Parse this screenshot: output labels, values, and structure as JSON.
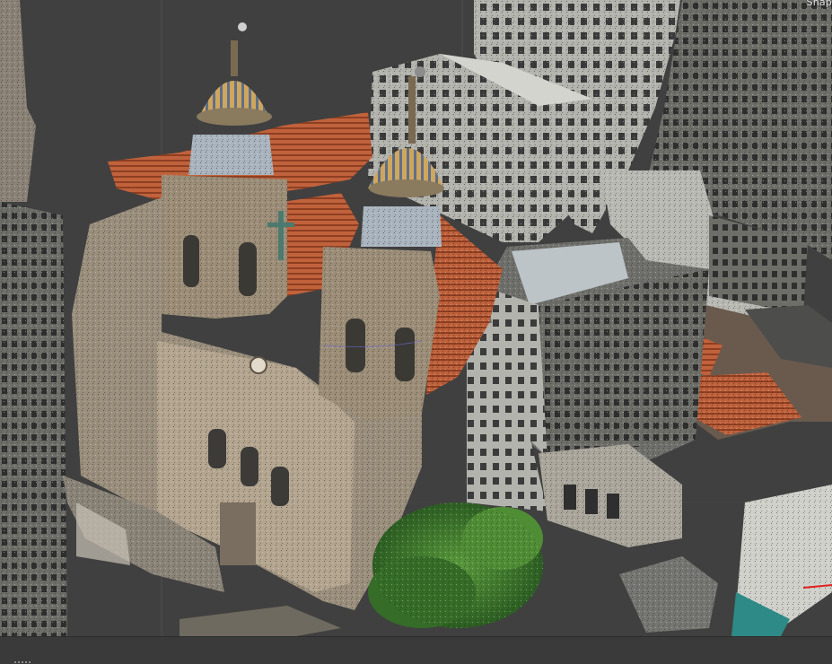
{
  "viewport": {
    "snap_label": "Snap"
  },
  "scene": {
    "subject": "point-cloud-reconstruction",
    "colors": {
      "background": "#404040",
      "grid_line": "#4e4e4e",
      "facade_stone": "#a89a86",
      "facade_shadow": "#5f564a",
      "roof_tile": "#c0623c",
      "dome_gold": "#c9a25a",
      "dome_tile": "#7f8fa6",
      "highrise_light": "#a9a9a4",
      "highrise_dark": "#4f4f4c",
      "tree_green": "#3d7d2f",
      "axis_red": "#e02020",
      "axis_teal": "#2d8a86"
    }
  }
}
